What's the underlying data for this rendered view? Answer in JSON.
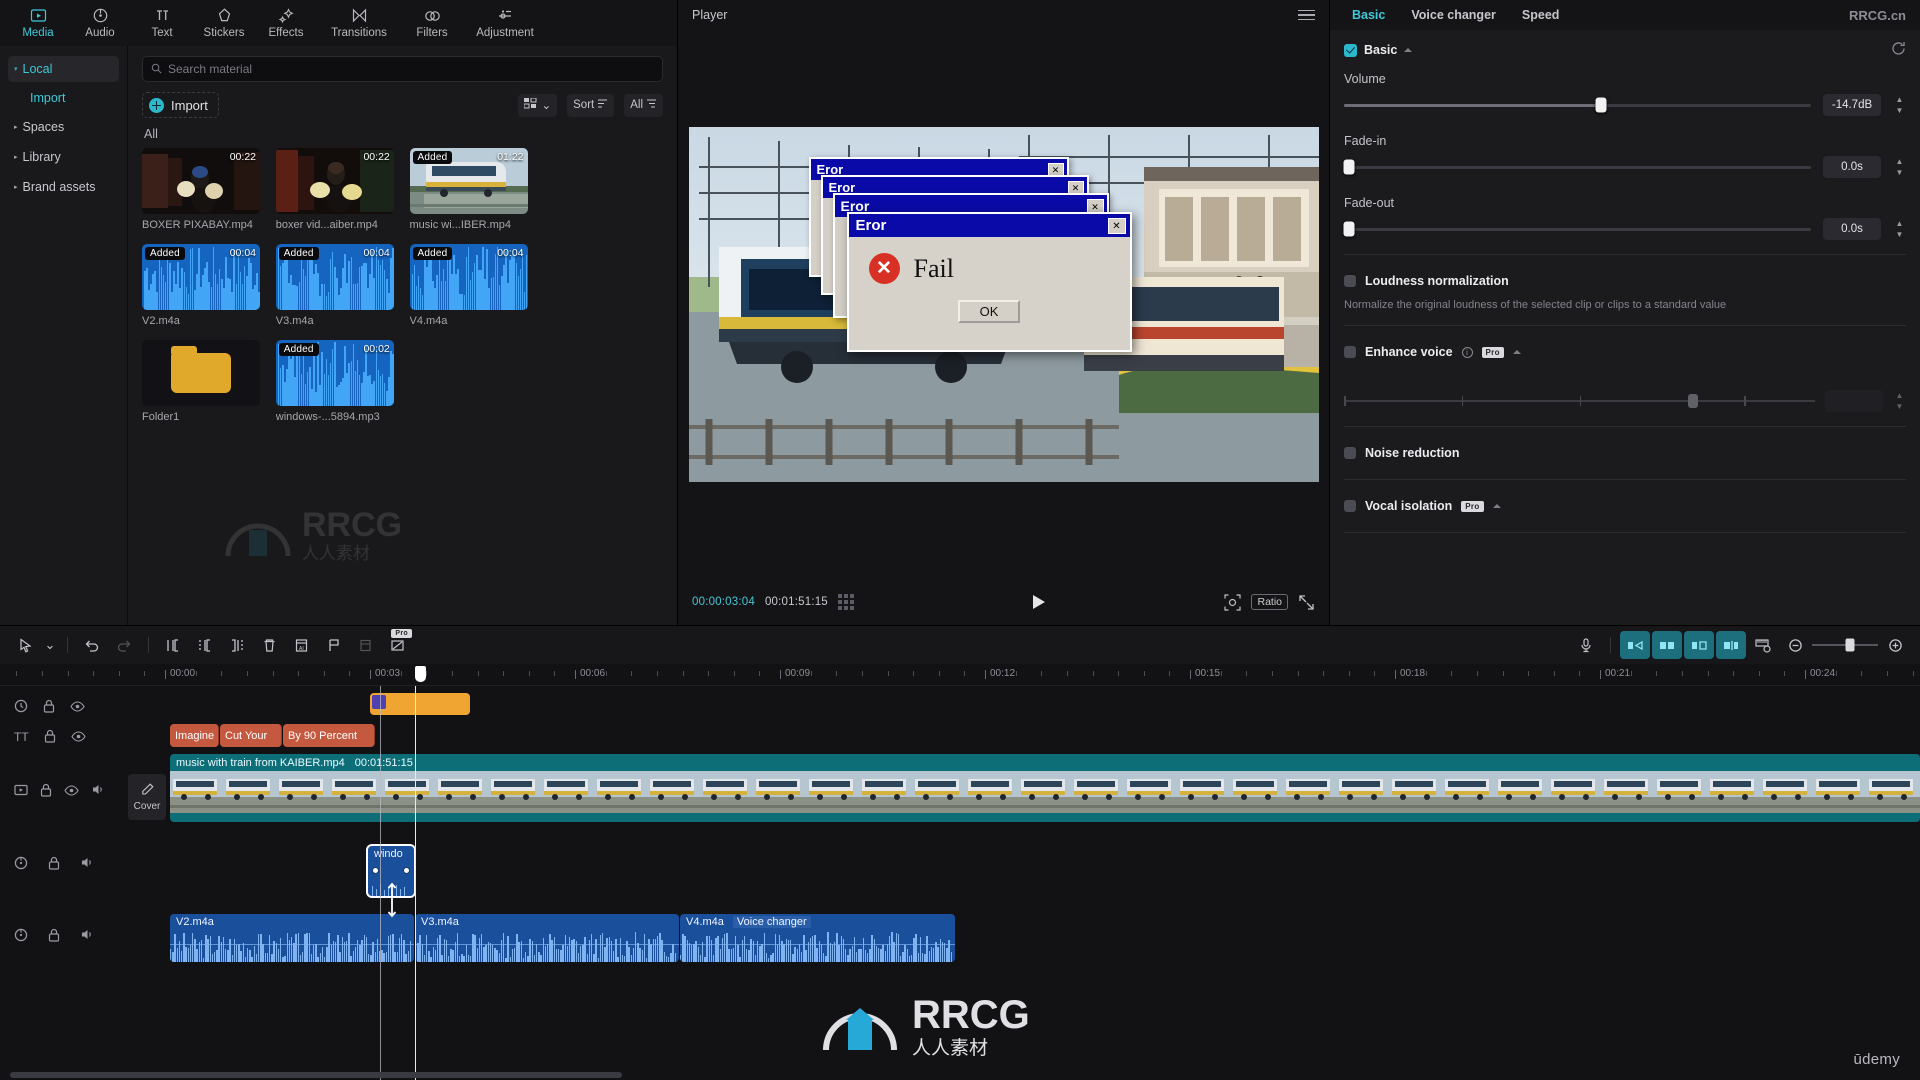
{
  "nav": {
    "tabs": [
      {
        "label": "Media",
        "icon": "media-icon",
        "active": true
      },
      {
        "label": "Audio",
        "icon": "audio-icon",
        "active": false
      },
      {
        "label": "Text",
        "icon": "text-icon",
        "active": false
      },
      {
        "label": "Stickers",
        "icon": "stickers-icon",
        "active": false
      },
      {
        "label": "Effects",
        "icon": "effects-icon",
        "active": false
      },
      {
        "label": "Transitions",
        "icon": "transitions-icon",
        "active": false
      },
      {
        "label": "Filters",
        "icon": "filters-icon",
        "active": false
      },
      {
        "label": "Adjustment",
        "icon": "adjustment-icon",
        "active": false
      }
    ]
  },
  "sidebar": {
    "items": [
      {
        "label": "Local",
        "selected": true,
        "caret": "▾"
      },
      {
        "label": "Spaces",
        "selected": false,
        "caret": "▸"
      },
      {
        "label": "Library",
        "selected": false,
        "caret": "▸"
      },
      {
        "label": "Brand assets",
        "selected": false,
        "caret": "▸"
      }
    ],
    "sub_item": "Import"
  },
  "media": {
    "search_placeholder": "Search material",
    "search_value": "",
    "import_label": "Import",
    "sort_label": "Sort",
    "all_filter_label": "All",
    "section_label": "All",
    "items": [
      {
        "name": "BOXER PIXABAY.mp4",
        "duration": "00:22",
        "added": false,
        "kind": "video-boxer-1"
      },
      {
        "name": "boxer vid...aiber.mp4",
        "duration": "00:22",
        "added": false,
        "kind": "video-boxer-2"
      },
      {
        "name": "music wi...IBER.mp4",
        "duration": "01:22",
        "added": true,
        "kind": "video-train"
      },
      {
        "name": "V2.m4a",
        "duration": "00:04",
        "added": true,
        "kind": "audio"
      },
      {
        "name": "V3.m4a",
        "duration": "00:04",
        "added": true,
        "kind": "audio"
      },
      {
        "name": "V4.m4a",
        "duration": "00:04",
        "added": true,
        "kind": "audio"
      },
      {
        "name": "Folder1",
        "duration": "",
        "added": false,
        "kind": "folder"
      },
      {
        "name": "windows-...5894.mp3",
        "duration": "00:02",
        "added": true,
        "kind": "audio-short"
      }
    ],
    "added_badge": "Added",
    "watermark": "RRCG"
  },
  "player": {
    "title": "Player",
    "current_time": "00:00:03:04",
    "total_time": "00:01:51:15",
    "ratio_label": "Ratio",
    "overlay_error_title": "Eror",
    "overlay_fail_text": "Fail",
    "overlay_ok_label": "OK"
  },
  "properties": {
    "tabs": [
      {
        "label": "Basic",
        "active": true
      },
      {
        "label": "Voice changer",
        "active": false
      },
      {
        "label": "Speed",
        "active": false
      }
    ],
    "brand_tag": "RRCG.cn",
    "section_title": "Basic",
    "section_checked": true,
    "controls": [
      {
        "label": "Volume",
        "value": "-14.7dB",
        "knob_pct": 55,
        "has_knob": true
      },
      {
        "label": "Fade-in",
        "value": "0.0s",
        "knob_pct": 0,
        "has_knob": true
      },
      {
        "label": "Fade-out",
        "value": "0.0s",
        "knob_pct": 0,
        "has_knob": true
      }
    ],
    "options": [
      {
        "label": "Loudness normalization",
        "checked": false,
        "desc": "Normalize the original loudness of the selected clip or clips to a standard value",
        "pro": false
      },
      {
        "label": "Enhance voice",
        "checked": false,
        "desc": "",
        "pro": true,
        "info": true
      },
      {
        "label": "Noise reduction",
        "checked": false,
        "desc": "",
        "pro": false
      },
      {
        "label": "Vocal isolation",
        "checked": false,
        "desc": "",
        "pro": true
      }
    ],
    "pro_badge": "Pro",
    "enhance_slider_pct": 74
  },
  "timeline": {
    "ruler_labels": [
      "00:00",
      "00:03",
      "00:06",
      "00:09",
      "00:12",
      "00:15",
      "00:18",
      "00:21",
      "00:24"
    ],
    "cover_label": "Cover",
    "clips": {
      "sticker": {
        "label": ""
      },
      "texts": [
        {
          "label": "Imagine"
        },
        {
          "label": "Cut Your"
        },
        {
          "label": "By 90 Percent"
        }
      ],
      "video": {
        "name": "music with train from KAIBER.mp4",
        "duration": "00:01:51:15"
      },
      "overlay_audio": {
        "label": "windo"
      },
      "audios": [
        {
          "name": "V2.m4a",
          "tag": ""
        },
        {
          "name": "V3.m4a",
          "tag": ""
        },
        {
          "name": "V4.m4a",
          "tag": "Voice changer"
        }
      ]
    }
  },
  "watermarks": {
    "rrcg_main": "RRCG",
    "rrcg_sub": "人人素材",
    "udemy": "ūdemy"
  }
}
